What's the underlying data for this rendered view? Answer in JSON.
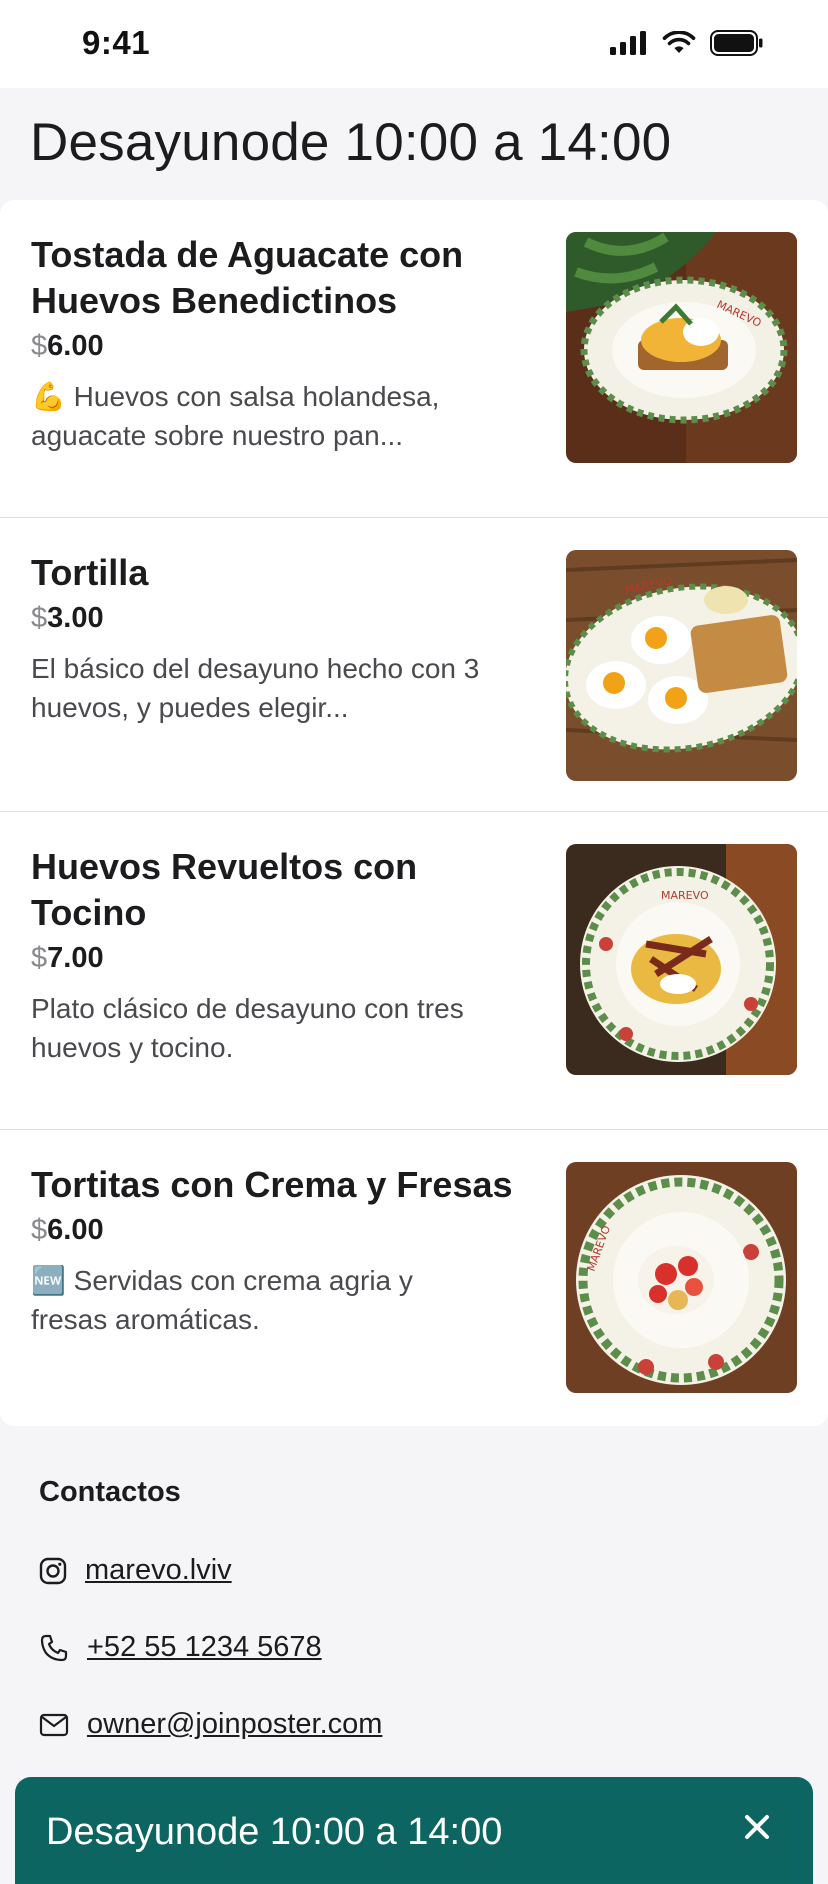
{
  "status_bar": {
    "time": "9:41"
  },
  "page": {
    "title": "Desayunode 10:00 a 14:00"
  },
  "menu": {
    "items": [
      {
        "name_line1": "Tostada de Aguacate con",
        "name_line2": "Huevos Benedictinos",
        "currency": "$",
        "price": "6.00",
        "desc_emoji": "💪",
        "desc_line1": " Huevos con salsa holandesa,",
        "desc_line2": "aguacate sobre nuestro pan..."
      },
      {
        "name_line1": "Tortilla",
        "name_line2": "",
        "currency": "$",
        "price": "3.00",
        "desc_emoji": "",
        "desc_line1": "El básico del desayuno hecho con 3",
        "desc_line2": "huevos, y puedes elegir..."
      },
      {
        "name_line1": "Huevos Revueltos con",
        "name_line2": "Tocino",
        "currency": "$",
        "price": "7.00",
        "desc_emoji": "",
        "desc_line1": "Plato clásico de desayuno con tres",
        "desc_line2": "huevos y tocino."
      },
      {
        "name_line1": "Tortitas con Crema y Fresas",
        "name_line2": "",
        "currency": "$",
        "price": "6.00",
        "desc_emoji": "🆕",
        "desc_line1": " Servidas con crema agria y",
        "desc_line2": "fresas aromáticas."
      }
    ],
    "plate_brand": "MAREVO"
  },
  "contacts": {
    "title": "Contactos",
    "instagram": "marevo.lviv",
    "phone": "+52 55 1234 5678",
    "email": "owner@joinposter.com"
  },
  "banner": {
    "text": "Desayunode 10:00 a 14:00"
  },
  "colors": {
    "banner_bg": "#0c6560",
    "page_bg": "#f5f5f7"
  }
}
